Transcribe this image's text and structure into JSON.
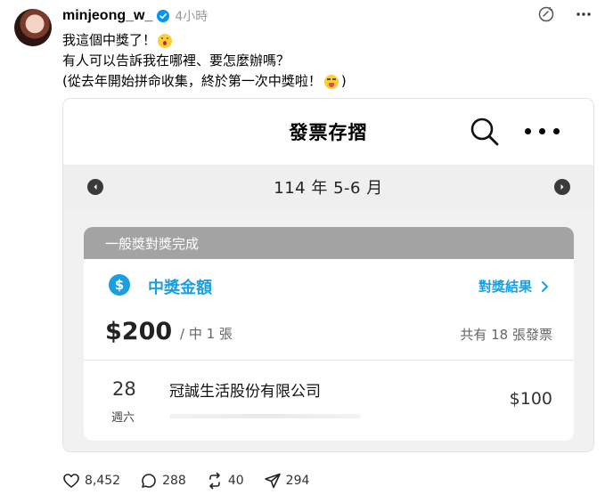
{
  "post": {
    "username": "minjeong_w_",
    "time": "4小時",
    "lines": [
      "我這個中獎了！",
      "有人可以告訴我在哪裡、要怎麼辦嗎？",
      "(從去年開始拼命收集，終於第一次中獎啦！",
      ")"
    ]
  },
  "app": {
    "title": "發票存摺",
    "period": "114 年 5-6 月",
    "result_header": "一般獎對獎完成",
    "prize_label": "中獎金額",
    "result_link": "對獎結果",
    "amount": "$200",
    "amount_sub": "/ 中 1 張",
    "total": "共有 18 張發票",
    "invoice": {
      "day": "28",
      "weekday": "週六",
      "merchant": "冠誠生活股份有限公司",
      "amount": "$100"
    }
  },
  "actions": {
    "likes": "8,452",
    "comments": "288",
    "reposts": "40",
    "shares": "294"
  },
  "colors": {
    "accent": "#1a9fe0",
    "verified": "#0095f6",
    "header_gray": "#a3a3a3",
    "emoji_yellow": "#ffcc33"
  },
  "icons": [
    "verified-icon",
    "ai-info-icon",
    "more-icon",
    "search-icon",
    "dollar-icon",
    "heart-icon",
    "comment-icon",
    "repost-icon",
    "share-icon"
  ]
}
